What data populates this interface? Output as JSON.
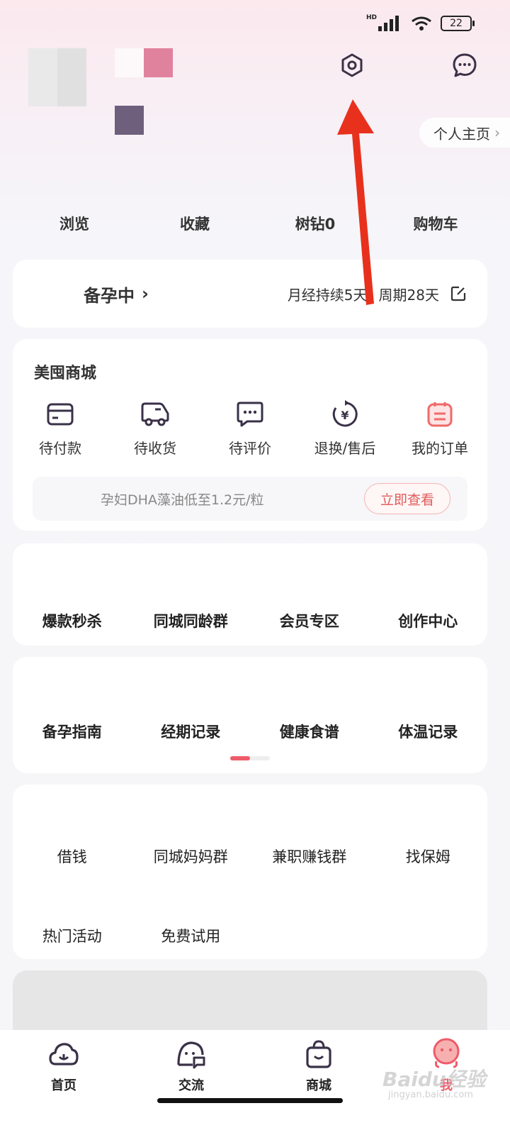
{
  "status_bar": {
    "network": "HD",
    "battery": "22"
  },
  "header": {
    "profile_link": "个人主页"
  },
  "quick_links": [
    "浏览",
    "收藏",
    "树钻0",
    "购物车"
  ],
  "status_card": {
    "stage": "备孕中",
    "period": "月经持续5天",
    "cycle": "周期28天"
  },
  "shop": {
    "title": "美囤商城",
    "orders": [
      {
        "label": "待付款",
        "icon": "wallet-icon"
      },
      {
        "label": "待收货",
        "icon": "truck-icon"
      },
      {
        "label": "待评价",
        "icon": "comment-icon"
      },
      {
        "label": "退换/售后",
        "icon": "refund-icon"
      },
      {
        "label": "我的订单",
        "icon": "order-list-icon"
      }
    ],
    "promo_text": "孕妇DHA藻油低至1.2元/粒",
    "promo_button": "立即查看"
  },
  "features_1": [
    "爆款秒杀",
    "同城同龄群",
    "会员专区",
    "创作中心"
  ],
  "features_2": [
    "备孕指南",
    "经期记录",
    "健康食谱",
    "体温记录"
  ],
  "features_3": [
    "借钱",
    "同城妈妈群",
    "兼职赚钱群",
    "找保姆",
    "热门活动",
    "免费试用"
  ],
  "tabbar": [
    {
      "label": "首页",
      "icon": "home-cloud-icon"
    },
    {
      "label": "交流",
      "icon": "community-icon"
    },
    {
      "label": "商城",
      "icon": "shopping-bag-icon"
    },
    {
      "label": "我",
      "icon": "profile-mascot-icon"
    }
  ],
  "colors": {
    "accent": "#ee5b6a",
    "arrow": "#e8311d",
    "dark": "#333333"
  },
  "watermark": {
    "main": "Baidu经验",
    "sub": "jingyan.baidu.com"
  }
}
